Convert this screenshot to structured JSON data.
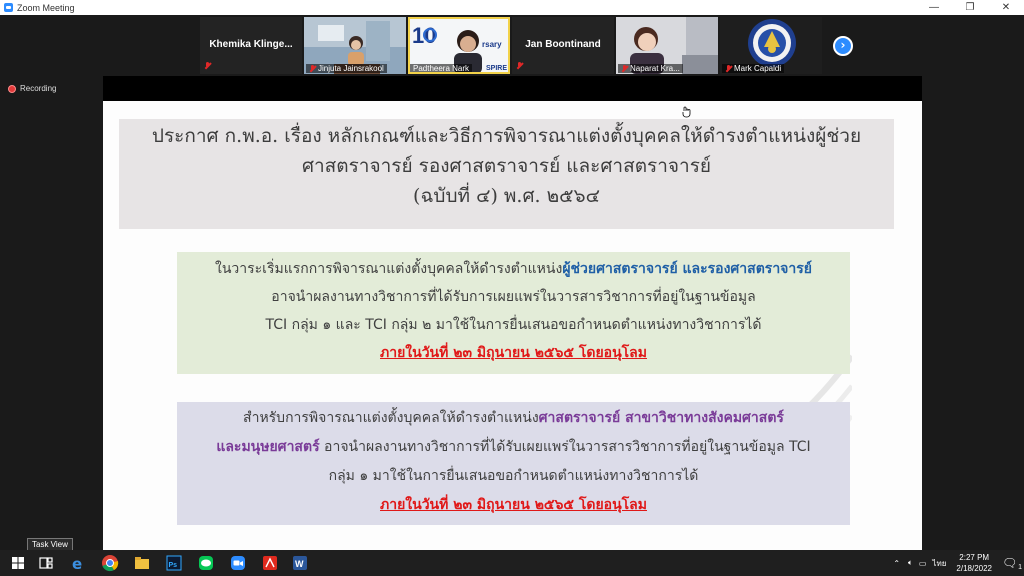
{
  "window": {
    "title": "Zoom Meeting",
    "controls": [
      "—",
      "❐",
      "✕"
    ]
  },
  "gallery": {
    "participants": [
      {
        "name": "Khemika  Klinge...",
        "video": false
      },
      {
        "name": "Jinjuta Jainsrakool",
        "video": true
      },
      {
        "name": "Padtheera Nark",
        "video": true,
        "speaking": true
      },
      {
        "name": "Jan Boontinand",
        "video": false
      },
      {
        "name": "Naparat Kra...",
        "video": true
      },
      {
        "name": "Mark Capaldi",
        "video": true
      }
    ],
    "next_label": "›"
  },
  "recording": {
    "label": "Recording"
  },
  "slide": {
    "title_lines": [
      "ประกาศ ก.พ.อ. เรื่อง หลักเกณฑ์และวิธีการพิจารณาแต่งตั้งบุคคลให้ดำรงตำแหน่งผู้ช่วย",
      "ศาสตราจารย์ รองศาสตราจารย์ และศาสตราจารย์",
      "(ฉบับที่ ๔) พ.ศ. ๒๕๖๔"
    ],
    "box1": {
      "line1_plain": "ในวาระเริ่มแรกการพิจารณาแต่งตั้งบุคคลให้ดำรงตำแหน่ง",
      "line1_highlight": "ผู้ช่วยศาสตราจารย์ และรองศาสตราจารย์",
      "line2": "อาจนำผลงานทางวิชาการที่ได้รับการเผยแพร่ในวารสารวิชาการที่อยู่ในฐานข้อมูล",
      "line3": "TCI กลุ่ม ๑ และ TCI กลุ่ม ๒ มาใช้ในการยื่นเสนอขอกำหนดตำแหน่งทางวิชาการได้",
      "deadline": "ภายในวันที่ ๒๓ มิถุนายน ๒๕๖๕ โดยอนุโลม"
    },
    "box2": {
      "line1_plain": "สำหรับการพิจารณาแต่งตั้งบุคคลให้ดำรงตำแหน่ง",
      "line1_highlight": "ศาสตราจารย์ สาขาวิชาทางสังคมศาสตร์",
      "line2_highlight": "และมนุษยศาสตร์",
      "line2_plain": " อาจนำผลงานทางวิชาการที่ได้รับเผยแพร่ในวารสารวิชาการที่อยู่ในฐานข้อมูล TCI",
      "line3": "กลุ่ม ๑ มาใช้ในการยื่นเสนอขอกำหนดตำแหน่งทางวิชาการได้",
      "deadline": "ภายในวันที่ ๒๓ มิถุนายน ๒๕๖๕ โดยอนุโลม"
    }
  },
  "taskbar": {
    "tooltip": "Task View",
    "apps": [
      "start-icon",
      "task-view-icon",
      "edge-icon",
      "chrome-icon",
      "file-explorer-icon",
      "photoshop-icon",
      "line-icon",
      "zoom-icon",
      "acrobat-icon",
      "word-icon"
    ],
    "input_language": "ไทย",
    "time": "2:27 PM",
    "date": "2/18/2022",
    "notification_count": "1"
  },
  "colors": {
    "accent": "#2d8cff",
    "deadline_red": "#e01818",
    "highlight_blue": "#1f5fa6",
    "highlight_purple": "#7a3b98"
  }
}
